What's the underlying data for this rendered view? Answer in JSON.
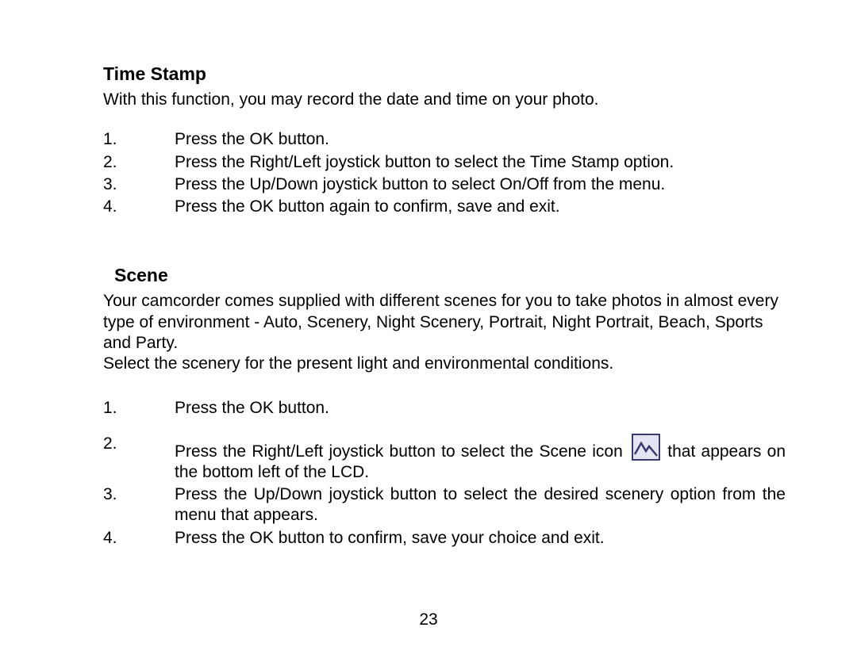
{
  "sections": {
    "timeStamp": {
      "heading": "Time Stamp",
      "intro": "With this function, you may record the date and time on your photo.",
      "steps": [
        "Press the OK button.",
        "Press the Right/Left joystick button to select the Time Stamp option.",
        "Press the Up/Down joystick button to select On/Off from the menu.",
        "Press the OK button again to confirm, save and exit."
      ]
    },
    "scene": {
      "heading": "Scene",
      "intro1": "Your camcorder comes supplied  with different scenes for you to take photos in almost every type of environment - Auto, Scenery, Night Scenery, Portrait, Night Portrait, Beach, Sports and Party.",
      "intro2": "Select the scenery for the present light and environmental conditions.",
      "steps": {
        "s1": "Press the OK button.",
        "s2a": "Press the Right/Left joystick button to select the Scene icon",
        "s2b": "that appears on the bottom left of the LCD.",
        "s3": "Press the Up/Down joystick button to select the desired scenery option from the menu that appears.",
        "s4": "Press the OK button to confirm, save your choice and exit."
      }
    }
  },
  "nums": {
    "n1": "1.",
    "n2": "2.",
    "n3": "3.",
    "n4": "4."
  },
  "pageNumber": "23"
}
